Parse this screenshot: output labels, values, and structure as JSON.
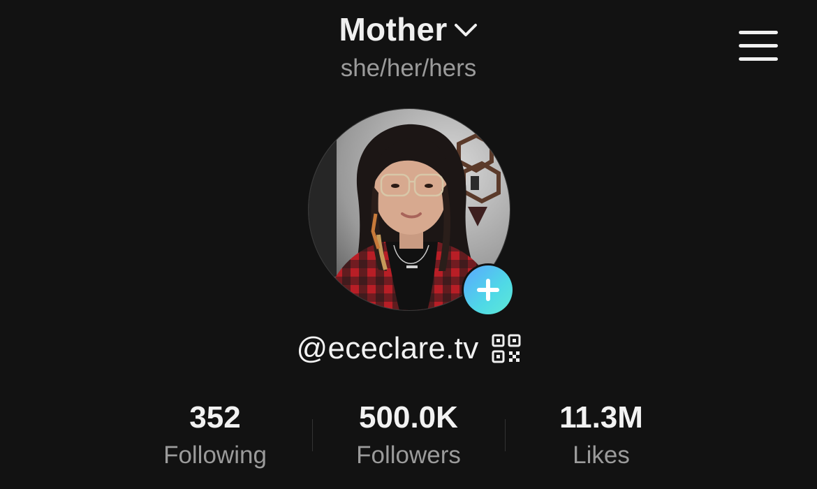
{
  "header": {
    "title": "Mother",
    "pronouns": "she/her/hers",
    "dropdown_icon": "chevron-down-icon",
    "menu_icon": "hamburger-menu-icon"
  },
  "profile": {
    "avatar_description_icon": "profile-photo",
    "add_icon": "plus-icon",
    "username": "@ececlare.tv",
    "qr_icon": "qr-code-icon"
  },
  "stats": [
    {
      "value": "352",
      "label": "Following"
    },
    {
      "value": "500.0K",
      "label": "Followers"
    },
    {
      "value": "11.3M",
      "label": "Likes"
    }
  ],
  "colors": {
    "background": "#121212",
    "primary_text": "#f2f2f2",
    "secondary_text": "#9b9b9b",
    "add_button_gradient_start": "#5aa7ff",
    "add_button_gradient_end": "#5fe8d6"
  }
}
